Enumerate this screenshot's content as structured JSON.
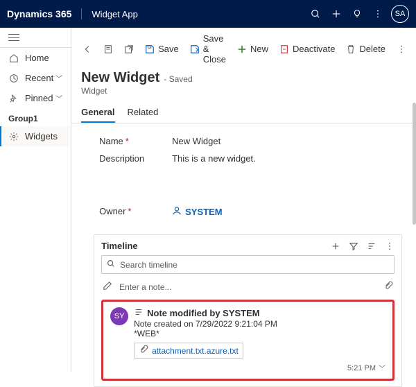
{
  "topbar": {
    "brand": "Dynamics 365",
    "app": "Widget App",
    "avatar": "SA"
  },
  "sidebar": {
    "home": "Home",
    "recent": "Recent",
    "pinned": "Pinned",
    "group": "Group1",
    "widgets": "Widgets"
  },
  "commands": {
    "save": "Save",
    "save_close": "Save & Close",
    "new": "New",
    "deactivate": "Deactivate",
    "delete": "Delete"
  },
  "header": {
    "title": "New Widget",
    "saved": "- Saved",
    "entity": "Widget"
  },
  "tabs": {
    "general": "General",
    "related": "Related"
  },
  "fields": {
    "name_label": "Name",
    "name_value": "New Widget",
    "desc_label": "Description",
    "desc_value": "This is a new widget.",
    "owner_label": "Owner",
    "owner_value": "SYSTEM"
  },
  "timeline": {
    "title": "Timeline",
    "search_ph": "Search timeline",
    "compose_ph": "Enter a note...",
    "note": {
      "avatar": "SY",
      "title": "Note modified by SYSTEM",
      "created": "Note created on 7/29/2022 9:21:04 PM",
      "body": "*WEB*",
      "attachment": "attachment.txt.azure.txt",
      "time": "5:21 PM"
    }
  }
}
